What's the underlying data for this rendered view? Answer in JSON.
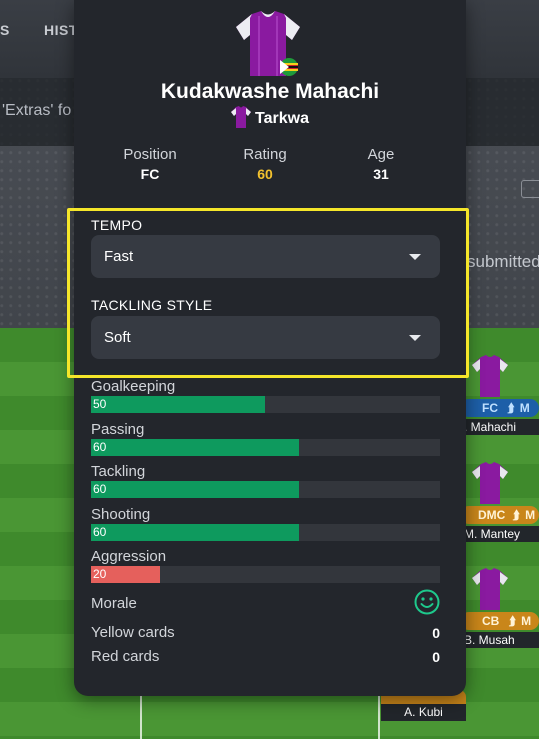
{
  "background": {
    "tabs": [
      "S",
      "HIST"
    ],
    "extras_text": "'Extras' fo",
    "submitted_text": "submitted",
    "lineup": [
      {
        "position": "FC",
        "name": ". Mahachi",
        "color": "#1d5fa8"
      },
      {
        "position": "DMC",
        "name": "M. Mantey",
        "color": "#c9861a"
      },
      {
        "position": "CB",
        "name": "B. Musah",
        "color": "#c9861a"
      }
    ],
    "extra_player": "A. Kubi",
    "mark": "M"
  },
  "player": {
    "name": "Kudakwashe Mahachi",
    "club": "Tarkwa",
    "jersey_color": "#8a1aa0"
  },
  "stats": [
    {
      "label": "Position",
      "value": "FC",
      "color": "#ffffff"
    },
    {
      "label": "Rating",
      "value": "60",
      "color": "#f2c12e"
    },
    {
      "label": "Age",
      "value": "31",
      "color": "#ffffff"
    }
  ],
  "tempo": {
    "label": "TEMPO",
    "value": "Fast"
  },
  "tackling_style": {
    "label": "TACKLING STYLE",
    "value": "Soft"
  },
  "attributes": [
    {
      "label": "Goalkeeping",
      "value": "50",
      "fraction": 0.5,
      "color": "#0e9a5e"
    },
    {
      "label": "Passing",
      "value": "60",
      "fraction": 0.6,
      "color": "#0e9a5e"
    },
    {
      "label": "Tackling",
      "value": "60",
      "fraction": 0.6,
      "color": "#0e9a5e"
    },
    {
      "label": "Shooting",
      "value": "60",
      "fraction": 0.6,
      "color": "#0e9a5e"
    },
    {
      "label": "Aggression",
      "value": "20",
      "fraction": 0.2,
      "color": "#e5605c"
    }
  ],
  "morale": {
    "label": "Morale",
    "icon": "smiley-face-icon",
    "color": "#1ec98c"
  },
  "cards": {
    "yellow_label": "Yellow cards",
    "yellow_value": "0",
    "red_label": "Red cards",
    "red_value": "0"
  }
}
